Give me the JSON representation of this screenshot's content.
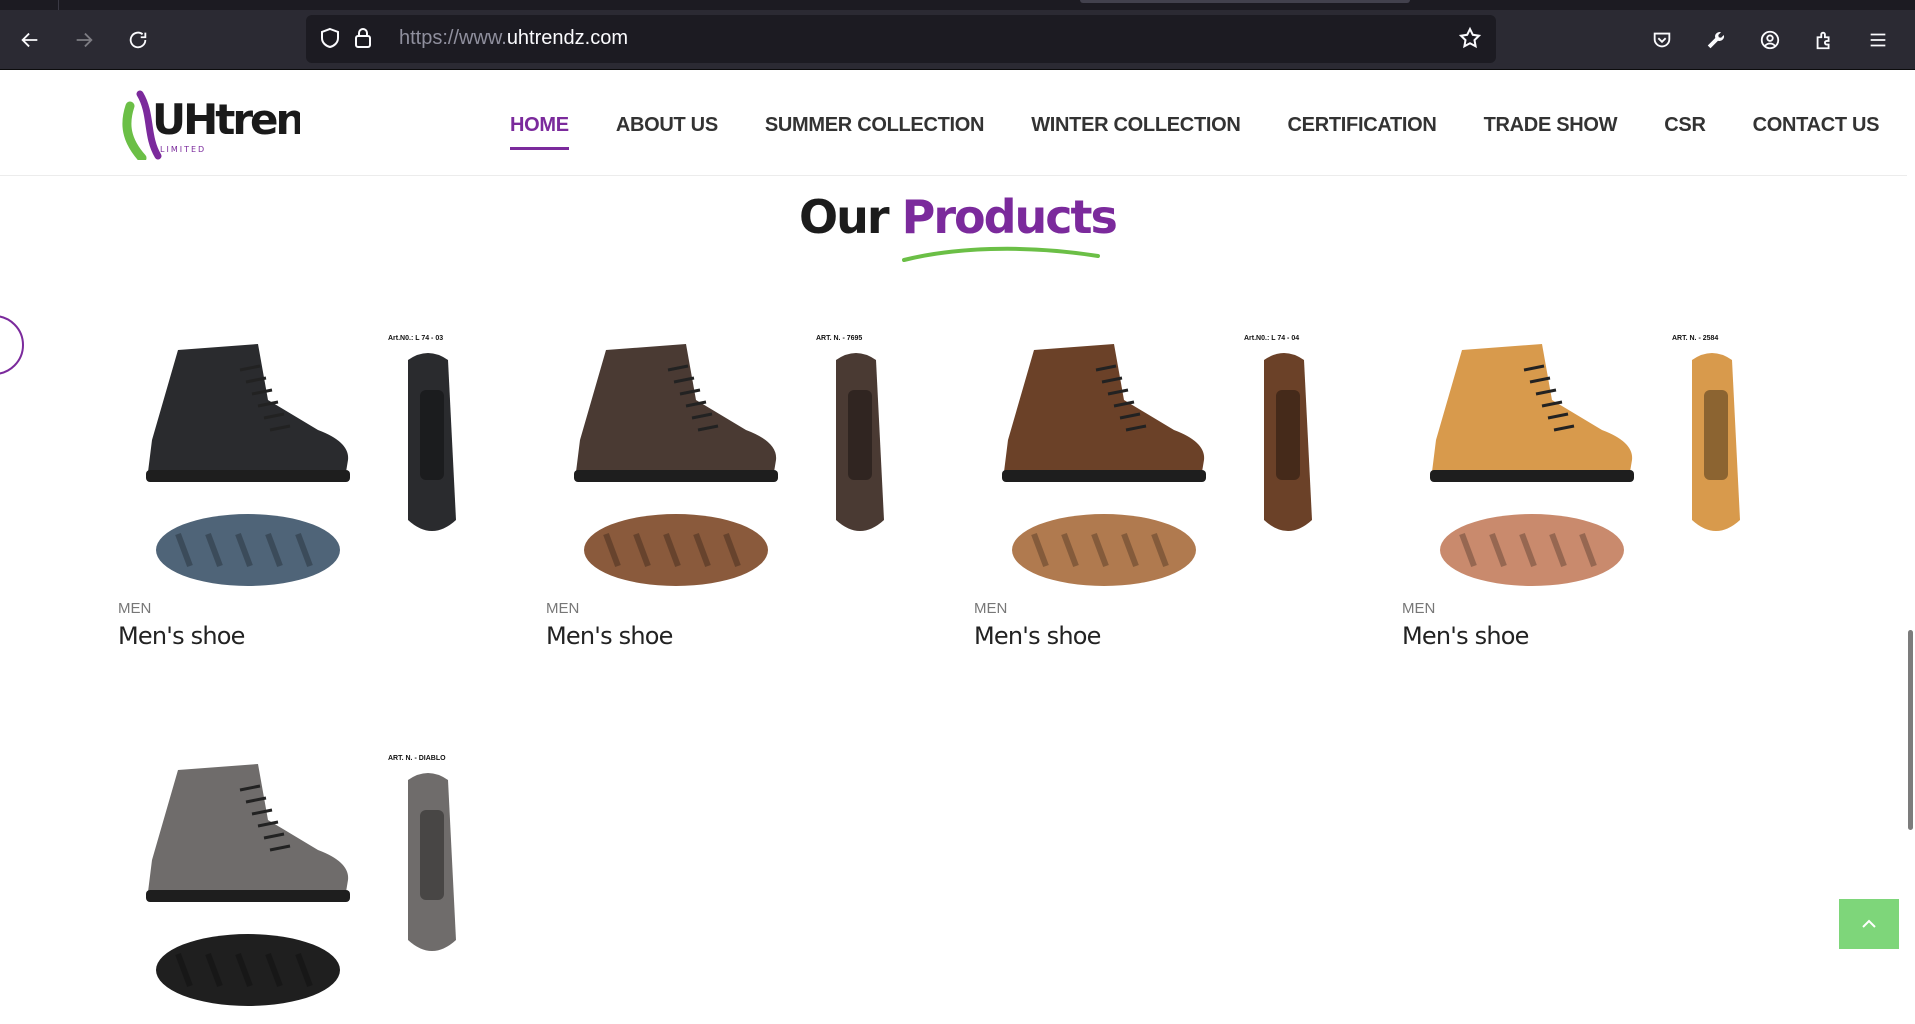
{
  "browser": {
    "url_prefix": "https://www.",
    "url_domain": "uhtrendz.com"
  },
  "site": {
    "logo_text": "UHtrendz",
    "logo_sub": "LIMITED",
    "nav": [
      {
        "label": "HOME",
        "active": true
      },
      {
        "label": "ABOUT US"
      },
      {
        "label": "SUMMER COLLECTION"
      },
      {
        "label": "WINTER COLLECTION"
      },
      {
        "label": "CERTIFICATION"
      },
      {
        "label": "TRADE SHOW"
      },
      {
        "label": "CSR"
      },
      {
        "label": "CONTACT US"
      }
    ]
  },
  "section": {
    "title_plain": "Our",
    "title_accent": "Products"
  },
  "products": [
    {
      "category": "MEN",
      "name": "Men's shoe",
      "art": "Art.N0.: L 74 - 03",
      "color": "#2a2b2e",
      "sole": "#4f6478"
    },
    {
      "category": "MEN",
      "name": "Men's shoe",
      "art": "ART. N. - 7695",
      "color": "#4a3a33",
      "sole": "#8a5a3c"
    },
    {
      "category": "MEN",
      "name": "Men's shoe",
      "art": "Art.N0.: L 74 - 04",
      "color": "#6b4128",
      "sole": "#b07a4f"
    },
    {
      "category": "MEN",
      "name": "Men's shoe",
      "art": "ART. N. - 2584",
      "color": "#d89a4c",
      "sole": "#c98a6d"
    },
    {
      "art": "ART. N. - DIABLO",
      "color": "#6f6c6b",
      "sole": "#1f1f1f"
    }
  ],
  "colors": {
    "brand_purple": "#7b2a9c",
    "brand_green": "#6bbf46"
  }
}
